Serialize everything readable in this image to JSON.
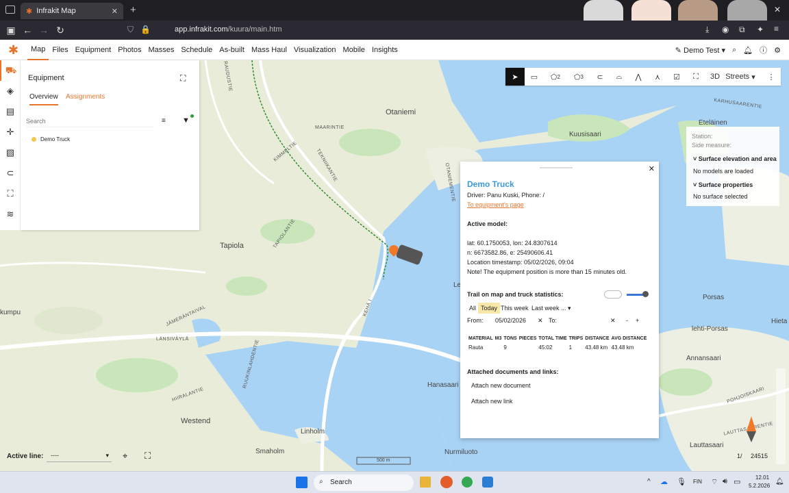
{
  "browser": {
    "tab_title": "Infrakit Map",
    "url_prefix": "app.infrakit.com",
    "url_path": "/kuura/main.htm"
  },
  "nav": {
    "items": [
      "Map",
      "Files",
      "Equipment",
      "Photos",
      "Masses",
      "Schedule",
      "As-built",
      "Mass Haul",
      "Visualization",
      "Mobile",
      "Insights"
    ],
    "user": "Demo Test"
  },
  "equipment_panel": {
    "title": "Equipment",
    "tabs": [
      "Overview",
      "Assignments"
    ],
    "search_placeholder": "Search",
    "items": [
      {
        "name": "Demo Truck",
        "status_color": "#f2c94c"
      }
    ]
  },
  "toolbar": {
    "measure_2": "2",
    "measure_3": "3",
    "view_3d": "3D",
    "basemap": "Streets"
  },
  "right_panel": {
    "station": "Station:",
    "side_measure": "Side measure:",
    "section1_title": "Surface elevation and area",
    "section1_text": "No models are loaded",
    "section2_title": "Surface properties",
    "section2_text": "No surface selected"
  },
  "popup": {
    "title": "Demo Truck",
    "driver": "Driver: Panu Kuski, Phone: /",
    "link": "To equipment's page",
    "active_model": "Active model:",
    "latlon": "lat: 60.1750053, lon: 24.8307614",
    "ne": "n: 6673582.86, e: 25490606.41",
    "timestamp": "Location timestamp: 05/02/2026, 09:04",
    "note": "Note! The equipment position is more than 15 minutes old.",
    "trail_label": "Trail on map and truck statistics:",
    "filters": [
      "All",
      "Today",
      "This week",
      "Last week ..."
    ],
    "from_label": "From:",
    "from_value": "05/02/2026",
    "to_label": "To:",
    "columns": [
      "MATERIAL",
      "M3",
      "TONS",
      "PIECES",
      "TOTAL TIME",
      "TRIPS",
      "DISTANCE",
      "AVG DISTANCE"
    ],
    "rows": [
      [
        "Rauta",
        "",
        "9",
        "",
        "45:02",
        "1",
        "43.48 km",
        "43.48 km"
      ]
    ],
    "docs_title": "Attached documents and links:",
    "attach_doc": "Attach new document",
    "attach_link": "Attach new link"
  },
  "map_labels": {
    "otaniemi": "Otaniemi",
    "kuusisaari": "Kuusisaari",
    "tapiola": "Tapiola",
    "westend": "Westend",
    "linholm": "Linholm",
    "smaholm": "Smaholm",
    "nurmiluoto": "Nurmiluoto",
    "hanasaari": "Hanasaari",
    "porsas": "Porsas",
    "annansaari": "Annansaari",
    "lauttasaari": "Lauttasaari",
    "etelainen": "Eteläinen",
    "kumpu": "kumpu",
    "hietal": "Hieta",
    "lenorsas": "lehti-Porsas",
    "le": "Le",
    "scale": "500 m",
    "page": "1/",
    "page_total": "24515"
  },
  "roads": [
    "RAUDUSTIE",
    "MAARINTIE",
    "KIMMELTIE",
    "TEKNIIKANTIE",
    "OTANIEMENTIE",
    "TAPIOLANTIE",
    "LÄNSIVÄYLÄ",
    "KEHÄ I",
    "HIIRALANTIE",
    "RUUKINLAHDENTIE",
    "JÄMERÄNTAIVAL",
    "LAUTTASAARENTIE",
    "POHJOISKAARI",
    "KARHUSAARENTIE"
  ],
  "active_line": {
    "label": "Active line:",
    "value": "----"
  },
  "taskbar": {
    "search": "Search",
    "lang": "FIN",
    "time": "12.01",
    "date": "5.2.2026"
  }
}
